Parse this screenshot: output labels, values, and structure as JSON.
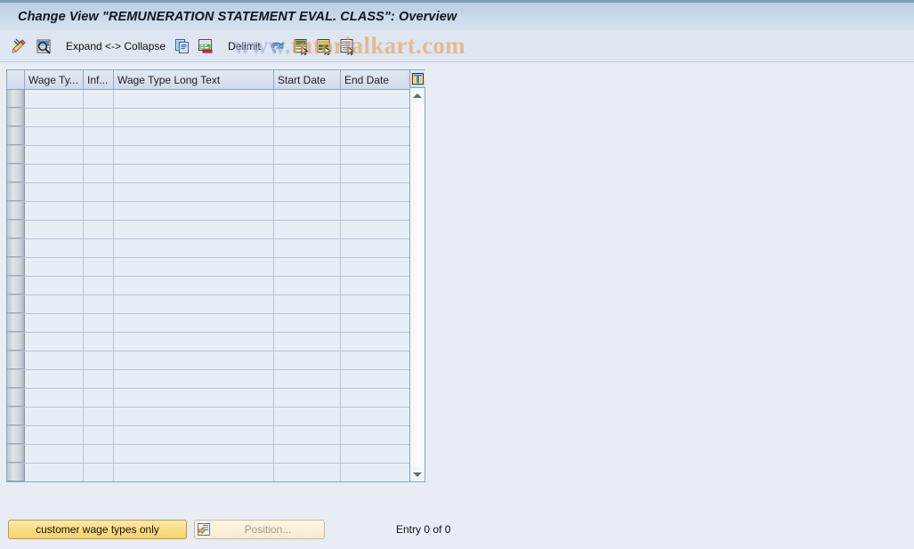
{
  "window": {
    "title": "Change View \"REMUNERATION STATEMENT EVAL. CLASS\": Overview"
  },
  "watermark": {
    "prefix": "www.",
    "text": "tutorialkart.com"
  },
  "toolbar": {
    "items": [
      {
        "name": "display-change-icon",
        "label": ""
      },
      {
        "name": "details-magnifier-icon",
        "label": ""
      },
      {
        "name": "expand-collapse-button",
        "label": "Expand <-> Collapse"
      },
      {
        "name": "copy-as-icon",
        "label": ""
      },
      {
        "name": "delete-row-icon",
        "label": ""
      },
      {
        "name": "delimit-button",
        "label": "Delimit"
      },
      {
        "name": "undo-icon",
        "label": ""
      },
      {
        "name": "previous-entry-icon",
        "label": ""
      },
      {
        "name": "next-entry-icon",
        "label": ""
      },
      {
        "name": "select-all-entries-icon",
        "label": ""
      }
    ],
    "expand_collapse_label": "Expand <-> Collapse",
    "delimit_label": "Delimit"
  },
  "table": {
    "columns": [
      {
        "key": "select",
        "label": ""
      },
      {
        "key": "wage_type",
        "label": "Wage Ty..."
      },
      {
        "key": "infotype",
        "label": "Inf..."
      },
      {
        "key": "long_text",
        "label": "Wage Type Long Text"
      },
      {
        "key": "start_date",
        "label": "Start Date"
      },
      {
        "key": "end_date",
        "label": "End Date"
      }
    ],
    "rows": [],
    "row_count": 21,
    "config_icon": "column-configuration-icon",
    "scroll_up_icon": "scroll-up-icon",
    "scroll_down_icon": "scroll-down-icon"
  },
  "footer": {
    "customer_wage_types_label": "customer wage types only",
    "position_label": "Position...",
    "position_icon": "position-list-icon",
    "entry_status": "Entry 0 of 0"
  },
  "colors": {
    "page_background": "#e8edf5",
    "titlebar_top": "#b9cde4",
    "titlebar_bottom": "#d7e3f1",
    "grid_cell": "#e8eef6",
    "grid_line": "#b7c4d6",
    "header_border": "#8ba5bf",
    "button_yellow": "#fbdd84",
    "watermark_orange": "#e8a05a"
  }
}
